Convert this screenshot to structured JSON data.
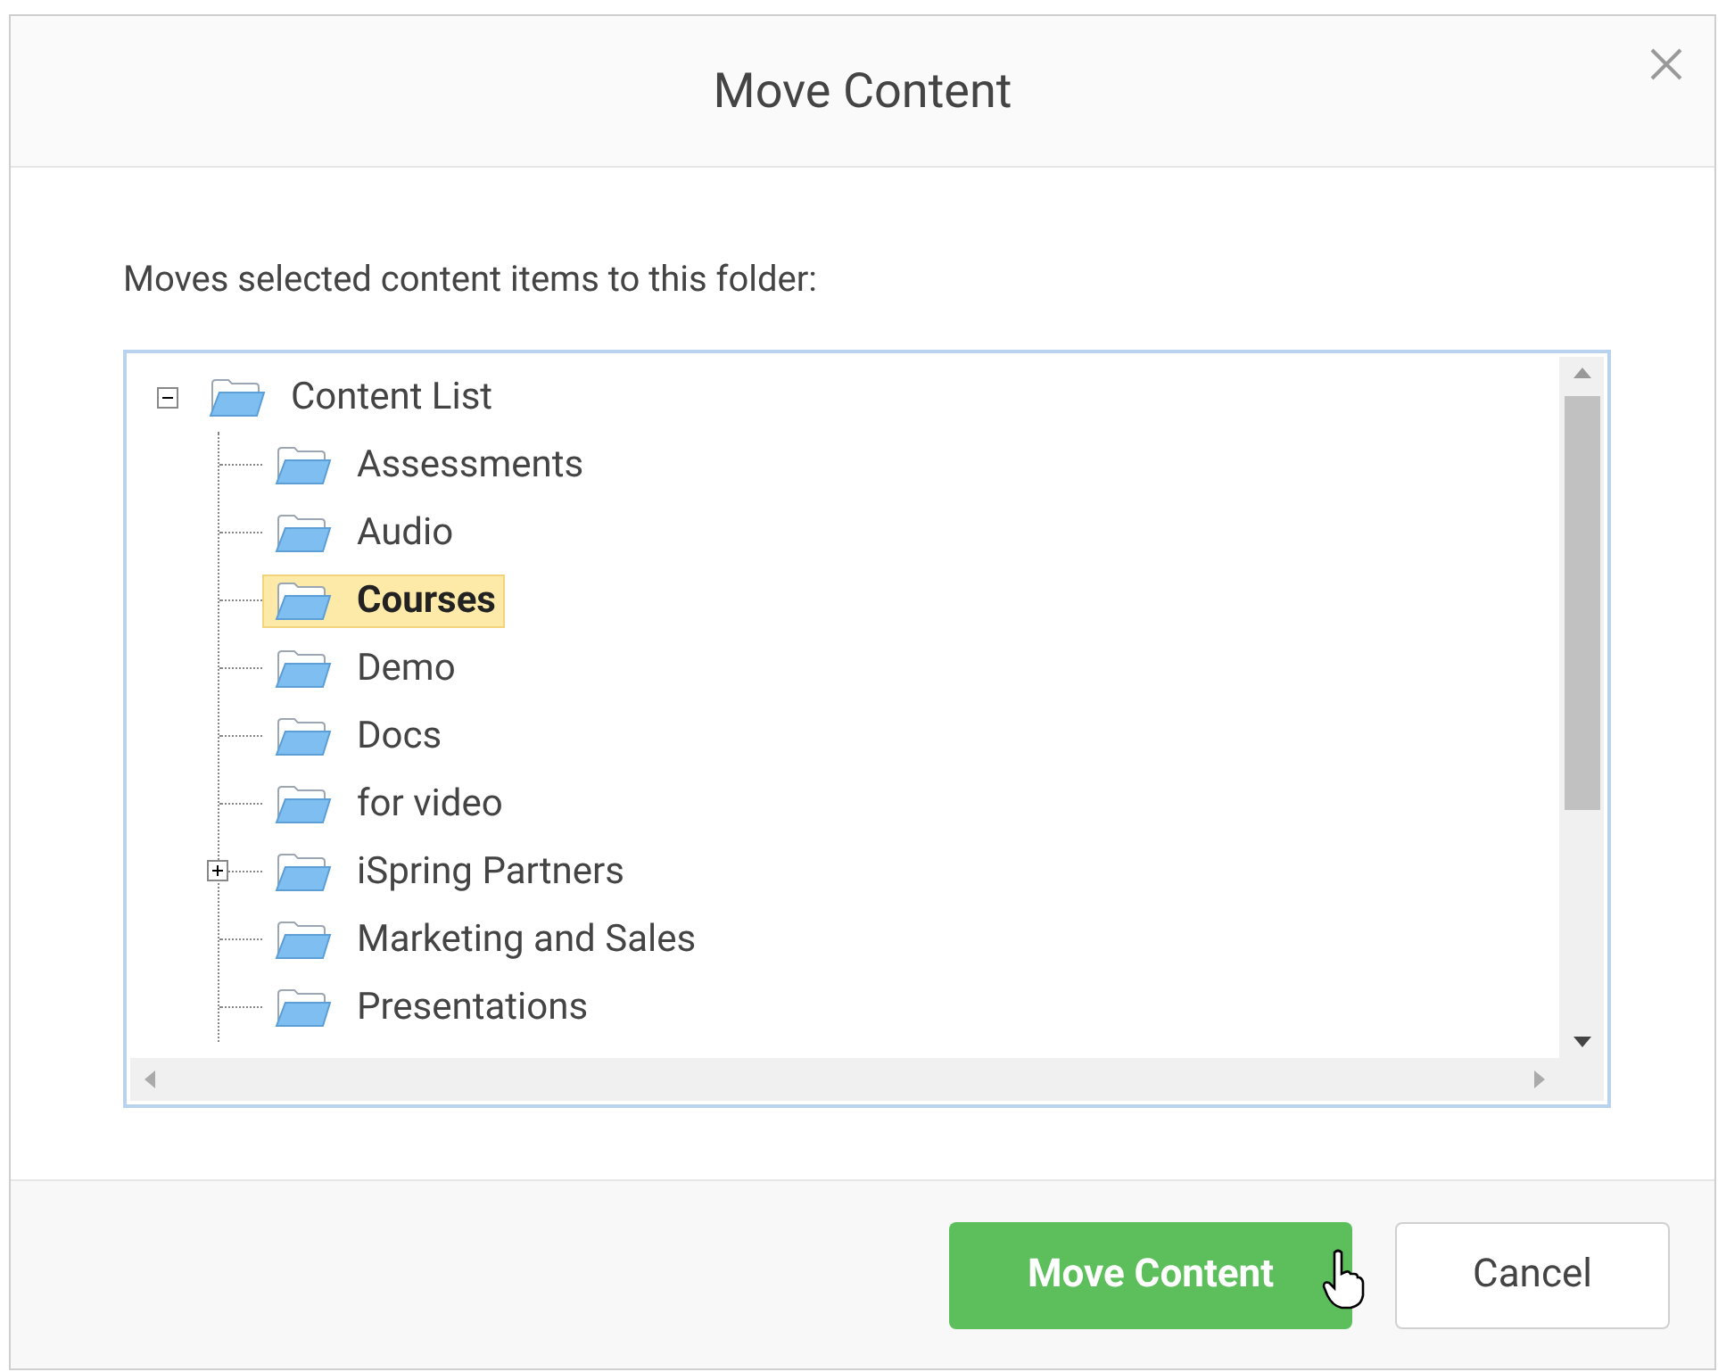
{
  "dialog": {
    "title": "Move Content"
  },
  "instruction": "Moves selected content items to this folder:",
  "tree": {
    "label": "Content List",
    "expanded": true,
    "selected": false,
    "children": [
      {
        "label": "Assessments",
        "expandable": false,
        "selected": false
      },
      {
        "label": "Audio",
        "expandable": false,
        "selected": false
      },
      {
        "label": "Courses",
        "expandable": false,
        "selected": true
      },
      {
        "label": "Demo",
        "expandable": false,
        "selected": false
      },
      {
        "label": "Docs",
        "expandable": false,
        "selected": false
      },
      {
        "label": "for video",
        "expandable": false,
        "selected": false
      },
      {
        "label": "iSpring Partners",
        "expandable": true,
        "selected": false
      },
      {
        "label": "Marketing and Sales",
        "expandable": false,
        "selected": false
      },
      {
        "label": "Presentations",
        "expandable": false,
        "selected": false
      }
    ]
  },
  "buttons": [
    {
      "label": "Move Content",
      "kind": "primary"
    },
    {
      "label": "Cancel",
      "kind": "secondary"
    }
  ]
}
